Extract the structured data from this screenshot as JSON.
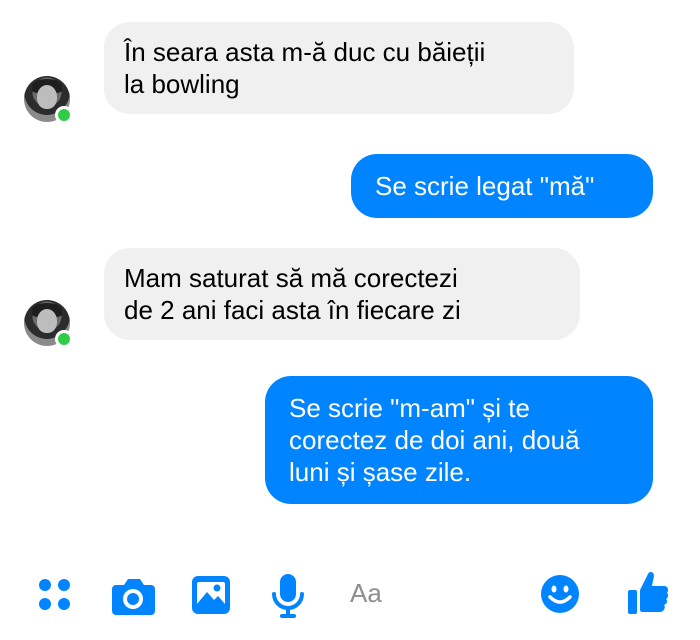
{
  "messages": [
    {
      "direction": "incoming",
      "lines": [
        "În seara asta m-ă duc cu băieții",
        "la bowling"
      ]
    },
    {
      "direction": "outgoing",
      "lines": [
        "Se scrie legat \"mă\""
      ]
    },
    {
      "direction": "incoming",
      "lines": [
        "Mam saturat să mă corectezi",
        "de 2 ani faci asta în fiecare zi"
      ]
    },
    {
      "direction": "outgoing",
      "lines": [
        "Se scrie \"m-am\" și te",
        "corectez de doi ani, două",
        "luni și șase zile."
      ]
    }
  ],
  "composer": {
    "placeholder": "Aa",
    "icons": [
      "more-options-icon",
      "camera-icon",
      "gallery-icon",
      "microphone-icon",
      "emoji-icon",
      "like-icon"
    ]
  },
  "colors": {
    "accent": "#0084ff",
    "incoming_bubble": "#f1f0f0",
    "online": "#31cc46"
  }
}
